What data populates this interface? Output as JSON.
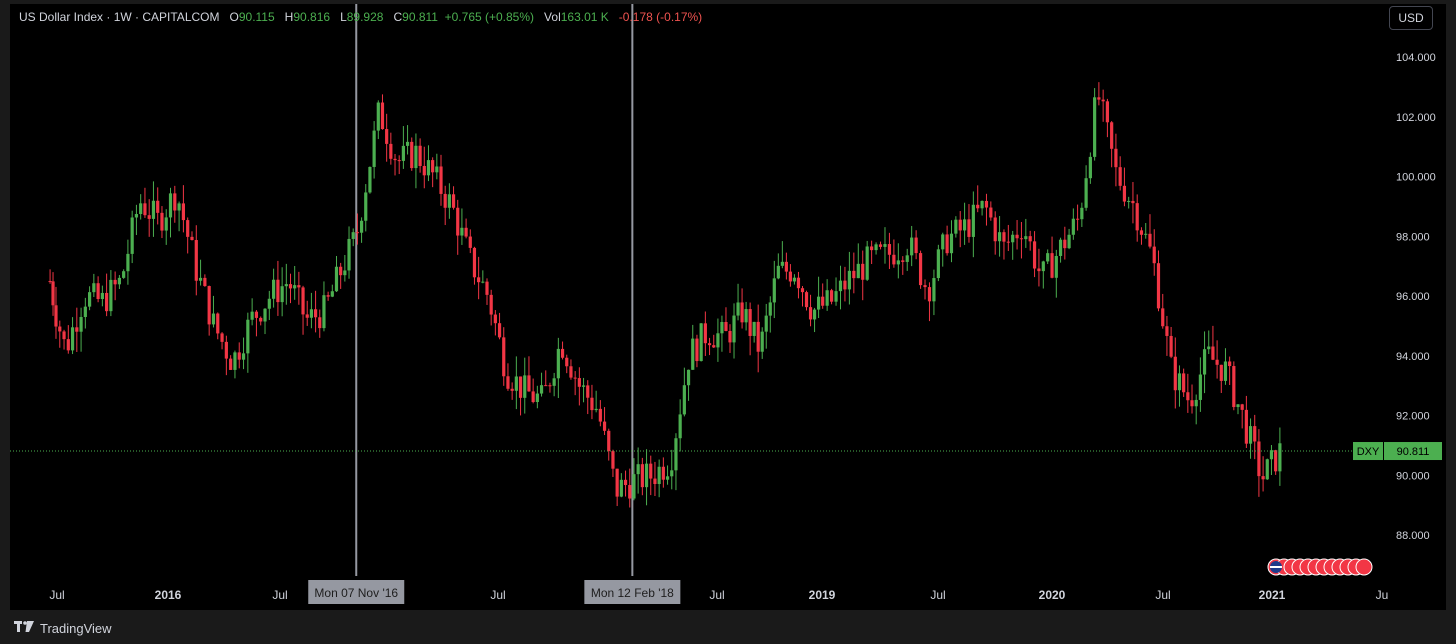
{
  "legend": {
    "symbol": "US Dollar Index · 1W · CAPITALCOM",
    "o_label": "O",
    "o_value": "90.115",
    "h_label": "H",
    "h_value": "90.816",
    "l_label": "L",
    "l_value": "89.928",
    "c_label": "C",
    "c_value": "90.811",
    "change": "+0.765 (+0.85%)",
    "vol_label": "Vol",
    "vol_value": "163.01 K",
    "vol_change": "-0.178 (-0.17%)"
  },
  "currency_button": "USD",
  "footer": {
    "brand": "TradingView",
    "logo_icon": "tradingview-logo-icon"
  },
  "colors": {
    "up": "#4caf50",
    "down": "#f23645",
    "background": "#000000",
    "last_price": "#4caf50"
  },
  "chart_data": {
    "type": "candlestick",
    "title": "US Dollar Index · 1W · CAPITALCOM",
    "ylim": [
      86.8,
      104.8
    ],
    "y_ticks": [
      "88.000",
      "90.000",
      "92.000",
      "94.000",
      "96.000",
      "98.000",
      "100.000",
      "102.000",
      "104.000"
    ],
    "x_ticks": [
      "Jul",
      "2016",
      "Jul",
      "Jul",
      "Jul",
      "2019",
      "Jul",
      "2020",
      "Jul",
      "2021",
      "Ju"
    ],
    "crosshair_labels": [
      "Mon 07 Nov '16",
      "Mon 12 Feb '18"
    ],
    "last_price": {
      "symbol": "DXY",
      "value": "90.811",
      "price": 90.811
    },
    "series": [
      {
        "name": "DXY close (approx weekly path)",
        "x": [
          "2015-06",
          "2015-07",
          "2015-08",
          "2015-09",
          "2015-10",
          "2015-11",
          "2015-12",
          "2016-01",
          "2016-02",
          "2016-03",
          "2016-04",
          "2016-05",
          "2016-06",
          "2016-07",
          "2016-08",
          "2016-09",
          "2016-10",
          "2016-11-07",
          "2016-12",
          "2017-01",
          "2017-02",
          "2017-03",
          "2017-04",
          "2017-05",
          "2017-06",
          "2017-07",
          "2017-08",
          "2017-09",
          "2017-10",
          "2017-11",
          "2017-12",
          "2018-01",
          "2018-02-12",
          "2018-03",
          "2018-04",
          "2018-05",
          "2018-06",
          "2018-07",
          "2018-08",
          "2018-09",
          "2018-10",
          "2018-11",
          "2018-12",
          "2019-01",
          "2019-02",
          "2019-03",
          "2019-04",
          "2019-05",
          "2019-06",
          "2019-07",
          "2019-08",
          "2019-09",
          "2019-10",
          "2019-11",
          "2019-12",
          "2020-01",
          "2020-02",
          "2020-03",
          "2020-04",
          "2020-05",
          "2020-06",
          "2020-07",
          "2020-08",
          "2020-09",
          "2020-10",
          "2020-11",
          "2020-12",
          "2021-01"
        ],
        "values": [
          96.5,
          94.2,
          96.0,
          95.8,
          96.5,
          99.2,
          98.5,
          99.5,
          97.0,
          95.0,
          93.8,
          95.2,
          96.0,
          96.5,
          95.2,
          95.5,
          97.0,
          98.0,
          102.2,
          100.5,
          100.8,
          100.0,
          99.0,
          97.2,
          96.0,
          93.5,
          92.8,
          92.5,
          94.5,
          93.0,
          92.2,
          89.5,
          89.8,
          90.0,
          90.5,
          94.0,
          94.8,
          94.6,
          95.5,
          94.2,
          96.8,
          96.9,
          95.5,
          95.8,
          96.6,
          97.2,
          97.4,
          97.8,
          96.2,
          97.9,
          98.3,
          99.0,
          97.6,
          98.4,
          96.6,
          97.6,
          98.6,
          102.8,
          100.1,
          99.0,
          97.2,
          93.5,
          92.5,
          94.0,
          93.5,
          91.8,
          89.9,
          90.8
        ]
      }
    ]
  }
}
